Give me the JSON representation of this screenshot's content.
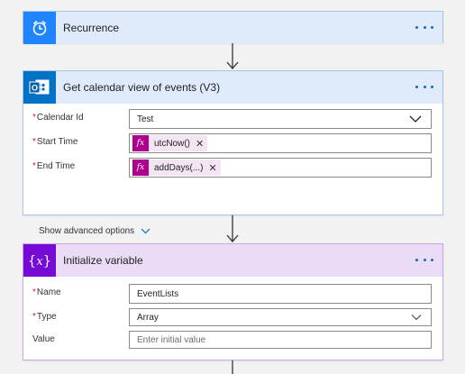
{
  "recurrence": {
    "title": "Recurrence",
    "icon": "alarm-clock-icon"
  },
  "calendar": {
    "title": "Get calendar view of events (V3)",
    "icon": "outlook-calendar-icon",
    "fields": {
      "calendar_id": {
        "label": "Calendar Id",
        "value": "Test"
      },
      "start_time": {
        "label": "Start Time",
        "token": "utcNow()"
      },
      "end_time": {
        "label": "End Time",
        "token": "addDays(...)"
      }
    },
    "advanced_label": "Show advanced options"
  },
  "variable": {
    "title": "Initialize variable",
    "icon": "variable-icon",
    "fields": {
      "name": {
        "label": "Name",
        "value": "EventLists"
      },
      "type": {
        "label": "Type",
        "value": "Array"
      },
      "value": {
        "label": "Value",
        "placeholder": "Enter initial value"
      }
    }
  },
  "colors": {
    "recurrence_accent": "#1f85ff",
    "calendar_accent": "#0072c6",
    "variable_accent": "#770bd6",
    "token": "#ad008c",
    "required": "#c4262e"
  }
}
